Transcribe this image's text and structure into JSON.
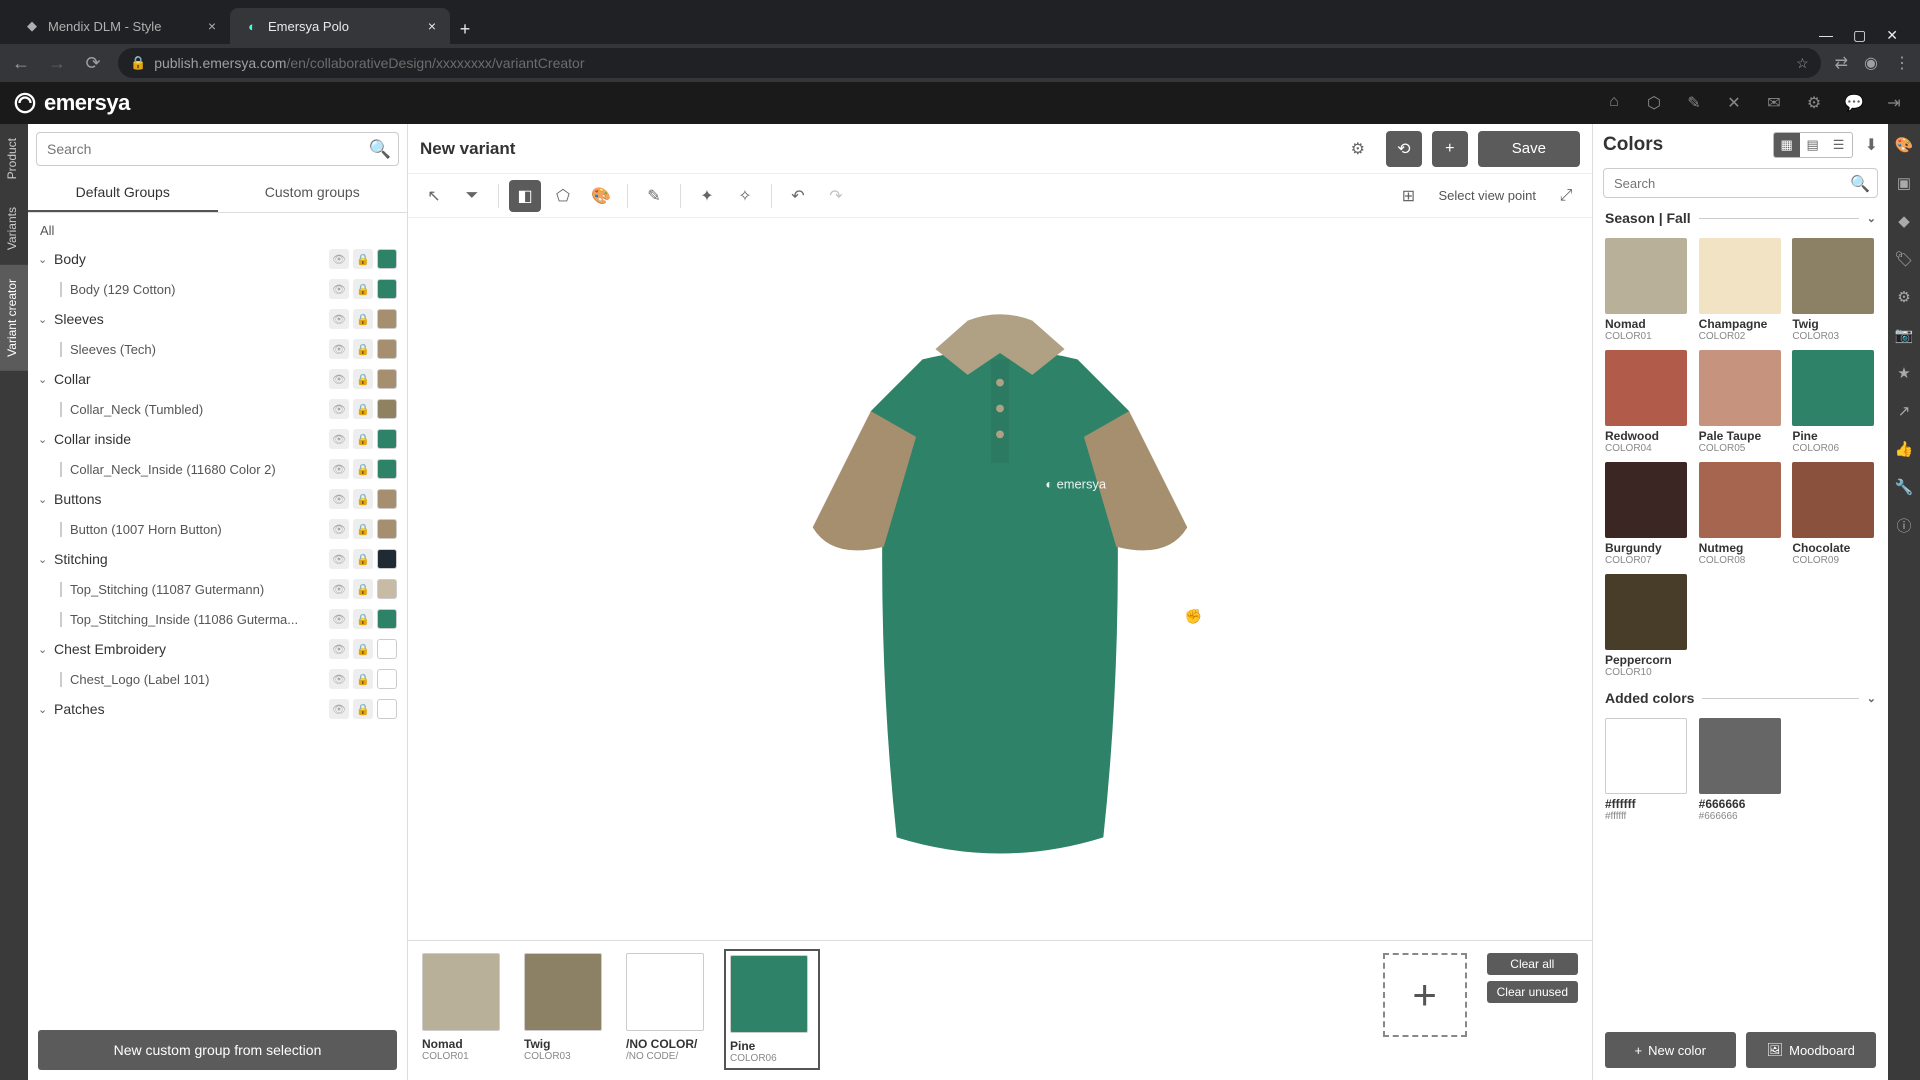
{
  "browser": {
    "tabs": [
      {
        "title": "Mendix DLM - Style",
        "active": false
      },
      {
        "title": "Emersya Polo",
        "active": true
      }
    ],
    "url_prefix": "publish.emersya.com",
    "url_suffix": "/en/collaborativeDesign/xxxxxxxx/variantCreator"
  },
  "app": {
    "name": "emersya"
  },
  "left_rail": [
    "Product",
    "Variants",
    "Variant creator"
  ],
  "left_panel": {
    "search_placeholder": "Search",
    "tabs": [
      "Default Groups",
      "Custom groups"
    ],
    "all_label": "All",
    "groups": [
      {
        "name": "Body",
        "color": "#2e8268",
        "children": [
          {
            "name": "Body (129 Cotton)",
            "color": "#2e8268"
          }
        ]
      },
      {
        "name": "Sleeves",
        "color": "#a68f6f",
        "children": [
          {
            "name": "Sleeves (Tech)",
            "color": "#a68f6f"
          }
        ]
      },
      {
        "name": "Collar",
        "color": "#a68f6f",
        "children": [
          {
            "name": "Collar_Neck (Tumbled)",
            "color": "#8f8260"
          }
        ]
      },
      {
        "name": "Collar inside",
        "color": "#2e8268",
        "children": [
          {
            "name": "Collar_Neck_Inside (11680 Color 2)",
            "color": "#2e8268"
          }
        ]
      },
      {
        "name": "Buttons",
        "color": "#a68f6f",
        "children": [
          {
            "name": "Button (1007 Horn Button)",
            "color": "#a68f6f"
          }
        ]
      },
      {
        "name": "Stitching",
        "color": "#1f2a33",
        "children": [
          {
            "name": "Top_Stitching (11087 Gutermann)",
            "color": "#c7bba5"
          },
          {
            "name": "Top_Stitching_Inside (11086 Guterma...",
            "color": "#2e8268"
          }
        ]
      },
      {
        "name": "Chest Embroidery",
        "color": "#ffffff",
        "children": [
          {
            "name": "Chest_Logo (Label 101)",
            "color": "#ffffff"
          }
        ]
      },
      {
        "name": "Patches",
        "color": "#ffffff",
        "children": []
      }
    ],
    "new_group_button": "New custom group from selection"
  },
  "center": {
    "title": "New variant",
    "save": "Save",
    "viewpoint": "Select view point",
    "used_colors": [
      {
        "name": "Nomad",
        "code": "COLOR01",
        "hex": "#b8b099"
      },
      {
        "name": "Twig",
        "code": "COLOR03",
        "hex": "#8c8065"
      },
      {
        "name": "/NO COLOR/",
        "code": "/NO CODE/",
        "hex": "#ffffff"
      },
      {
        "name": "Pine",
        "code": "COLOR06",
        "hex": "#2e8268",
        "selected": true
      }
    ],
    "clear_all": "Clear all",
    "clear_unused": "Clear unused"
  },
  "right_panel": {
    "title": "Colors",
    "search_placeholder": "Search",
    "season_label": "Season | Fall",
    "season_colors": [
      {
        "name": "Nomad",
        "code": "COLOR01",
        "hex": "#b8b099"
      },
      {
        "name": "Champagne",
        "code": "COLOR02",
        "hex": "#f2e3c4"
      },
      {
        "name": "Twig",
        "code": "COLOR03",
        "hex": "#8c8065"
      },
      {
        "name": "Redwood",
        "code": "COLOR04",
        "hex": "#b15b4a"
      },
      {
        "name": "Pale Taupe",
        "code": "COLOR05",
        "hex": "#c6937f"
      },
      {
        "name": "Pine",
        "code": "COLOR06",
        "hex": "#2e8268"
      },
      {
        "name": "Burgundy",
        "code": "COLOR07",
        "hex": "#3c2623"
      },
      {
        "name": "Nutmeg",
        "code": "COLOR08",
        "hex": "#a6654f"
      },
      {
        "name": "Chocolate",
        "code": "COLOR09",
        "hex": "#8a523d"
      },
      {
        "name": "Peppercorn",
        "code": "COLOR10",
        "hex": "#473d28"
      }
    ],
    "added_label": "Added colors",
    "added_colors": [
      {
        "name": "#ffffff",
        "code": "#ffffff",
        "hex": "#ffffff"
      },
      {
        "name": "#666666",
        "code": "#666666",
        "hex": "#666666"
      }
    ],
    "new_color": "New color",
    "moodboard": "Moodboard"
  },
  "polo": {
    "body": "#2e8268",
    "sleeves": "#a68f6f",
    "collar": "#b0a184"
  }
}
